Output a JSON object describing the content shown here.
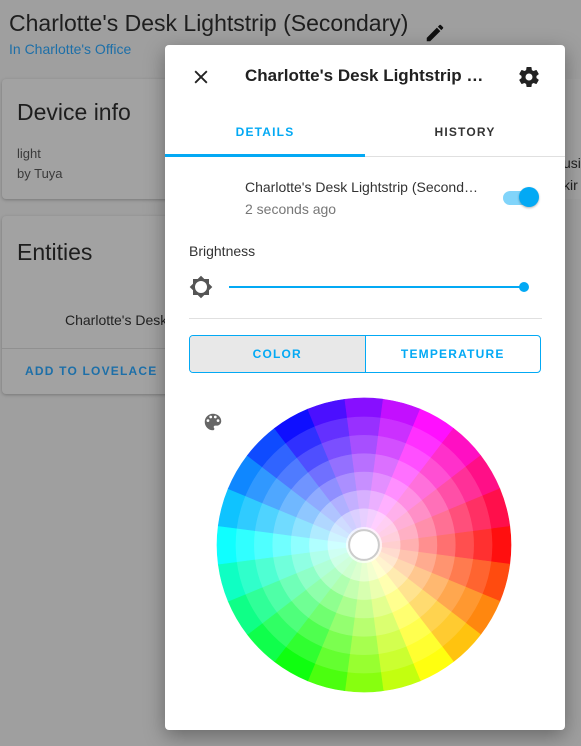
{
  "background": {
    "title": "Charlotte's Desk Lightstrip (Secondary)",
    "area_link": "In Charlotte's Office",
    "device_info": {
      "heading": "Device info",
      "model": "light",
      "manufacturer": "by Tuya"
    },
    "entities": {
      "heading": "Entities",
      "entity": "Charlotte's Desk",
      "action": "ADD TO LOVELACE"
    },
    "right_partial": [
      "usi",
      "kir"
    ]
  },
  "dialog": {
    "title": "Charlotte's Desk Lightstrip (Secondary)",
    "tabs": [
      {
        "label": "DETAILS",
        "active": true
      },
      {
        "label": "HISTORY",
        "active": false
      }
    ],
    "entity": {
      "name": "Charlotte's Desk Lightstrip (Secondary)",
      "last_changed": "2 seconds ago",
      "state_on": true
    },
    "brightness": {
      "label": "Brightness",
      "value_percent": 100
    },
    "mode_buttons": [
      {
        "label": "COLOR",
        "selected": true
      },
      {
        "label": "TEMPERATURE",
        "selected": false
      }
    ],
    "color_wheel": {
      "selected": "#ffffff",
      "hue_segments": 24,
      "saturation_rings": 8
    }
  },
  "colors": {
    "accent": "#03a9f4",
    "toggle_track": "#81d4fa",
    "link": "#1d6fa8"
  }
}
